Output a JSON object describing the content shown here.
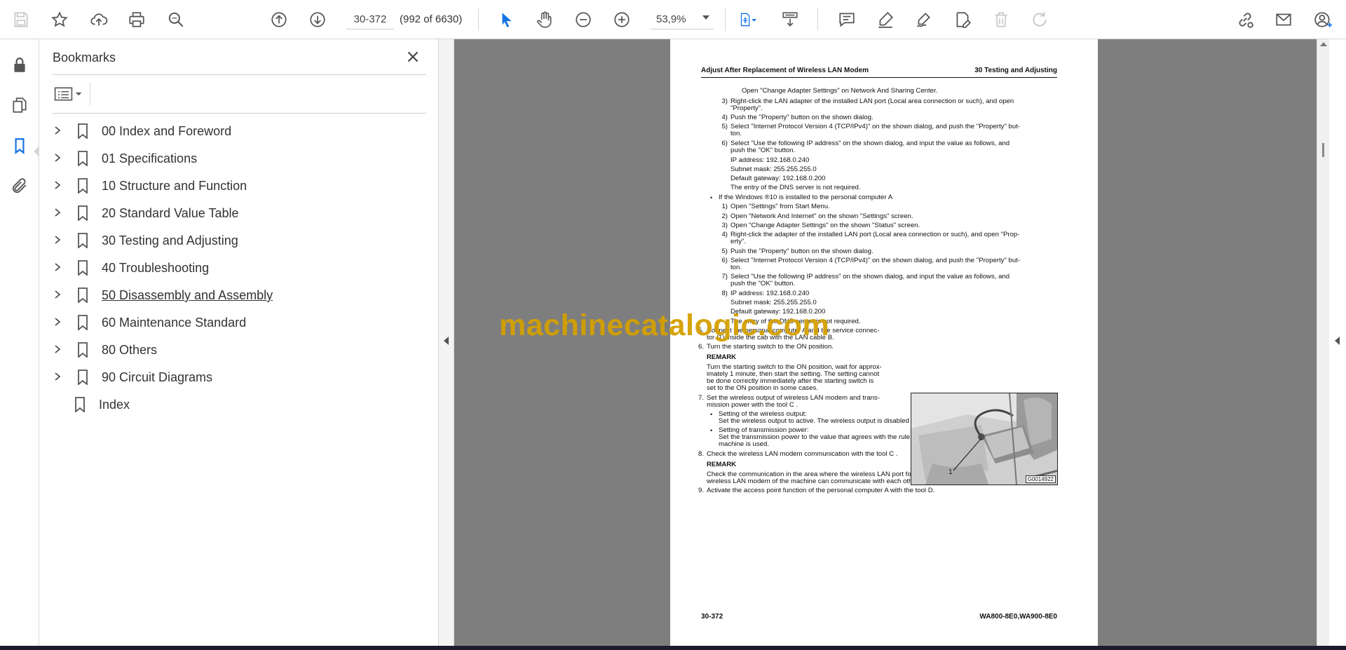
{
  "toolbar": {
    "page_value": "30-372",
    "page_count": "(992 of 6630)",
    "zoom": "53,9%"
  },
  "bookmarks": {
    "title": "Bookmarks",
    "items": [
      {
        "label": "00 Index and Foreword",
        "expandable": true
      },
      {
        "label": "01 Specifications",
        "expandable": true
      },
      {
        "label": "10 Structure and Function",
        "expandable": true
      },
      {
        "label": "20 Standard Value Table",
        "expandable": true
      },
      {
        "label": "30 Testing and Adjusting",
        "expandable": true
      },
      {
        "label": "40 Troubleshooting",
        "expandable": true
      },
      {
        "label": "50 Disassembly and Assembly",
        "expandable": true
      },
      {
        "label": "60 Maintenance Standard",
        "expandable": true
      },
      {
        "label": "80 Others",
        "expandable": true
      },
      {
        "label": "90 Circuit Diagrams",
        "expandable": true
      },
      {
        "label": "Index",
        "expandable": false
      }
    ]
  },
  "doc_page": {
    "header_left": "Adjust After Replacement of Wireless LAN Modem",
    "header_right": "30 Testing and Adjusting",
    "footer_left": "30-372",
    "footer_right": "WA800-8E0,WA900-8E0",
    "figure_label_1": "1",
    "figure_caption": "G0014922",
    "lines": [
      "Open \"Change Adapter Settings\" on Network And Sharing Center.",
      "Right-click the LAN adapter of the installed LAN port (Local area connection or such), and open",
      "\"Property\".",
      "Push the \"Property\" button on the shown dialog.",
      "Select \"Internet Protocol Version 4 (TCP/IPv4)\" on the shown dialog, and push the \"Property\" but-",
      "ton.",
      "Select \"Use the following IP address\" on the shown dialog, and input the value as follows, and",
      "push the \"OK\" button.",
      "IP address: 192.168.0.240",
      "Subnet mask: 255.255.255.0",
      "Default gateway: 192.168.0.200",
      "The entry of the DNS server is not required.",
      "If the Windows ®10 is installed to the personal computer A",
      "Open \"Settings\" from Start Menu.",
      "Open \"Network And Internet\" on the shown \"Settings\" screen.",
      "Open \"Change Adapter Settings\" on the shown \"Status\" screen.",
      "Right-click the adapter of the installed LAN port (Local area connection or such), and open \"Prop-",
      "erty\".",
      "Push the \"Property\" button on the shown dialog.",
      "Select \"Internet Protocol Version 4 (TCP/IPv4)\" on the shown dialog, and push the \"Property\" but-",
      "ton.",
      "Select \"Use the following IP address\" on the shown dialog, and input the value as follows, and",
      "push the \"OK\" button.",
      "IP address: 192.168.0.240",
      "Subnet mask: 255.255.255.0",
      "Default gateway: 192.168.0.200",
      "The entry of the DNS server is not required.",
      "Connect the personal computer A and the service connec-",
      "tor (1) inside the cab with the LAN cable B.",
      "Turn the starting switch to the ON position.",
      "REMARK",
      "Turn the starting switch to the ON position, wait for approx-",
      "imately 1 minute, then start the setting. The setting cannot",
      "be done correctly immediately after the starting switch is",
      "set to the ON position in some cases.",
      "Set the wireless output of wireless LAN modem and trans-",
      "mission power with the tool C .",
      "Setting of the wireless output:",
      "Set the wireless output to active. The wireless output is disabled at shipment.",
      "Setting of transmission power:",
      "Set the transmission power to the value that agrees with the rule of the country or region where the",
      "machine is used.",
      "Check the wireless LAN modem communication with the tool C .",
      "REMARK",
      "Check the communication in the area where the wireless LAN port for the personal computer A and the",
      "wireless LAN modem of the machine can communicate with each other.",
      "Activate the access point function of the personal computer A with the tool D."
    ],
    "numbers": [
      "3)",
      "4)",
      "5)",
      "6)",
      "1)",
      "2)",
      "3)",
      "4)",
      "5)",
      "6)",
      "7)",
      "8)",
      "5.",
      "6.",
      "7.",
      "8.",
      "9."
    ],
    "bullet": "•"
  },
  "watermark": "machinecatalogic.com",
  "colors": {
    "accent": "#1473e6",
    "doc_background": "#7e7e7e",
    "watermark": "#d4a000"
  },
  "icons": [
    "save-icon",
    "star-icon",
    "upload-icon",
    "print-icon",
    "zoom-search-icon",
    "page-up-icon",
    "page-down-icon",
    "select-arrow-icon",
    "hand-icon",
    "zoom-out-icon",
    "zoom-in-icon",
    "fit-page-icon",
    "scroll-mode-icon",
    "comment-icon",
    "highlight-icon",
    "sign-icon",
    "edit-pdf-icon",
    "delete-icon",
    "redo-icon",
    "share-link-icon",
    "email-icon",
    "account-icon",
    "lock-icon",
    "pages-icon",
    "bookmark-icon",
    "attachment-icon"
  ]
}
